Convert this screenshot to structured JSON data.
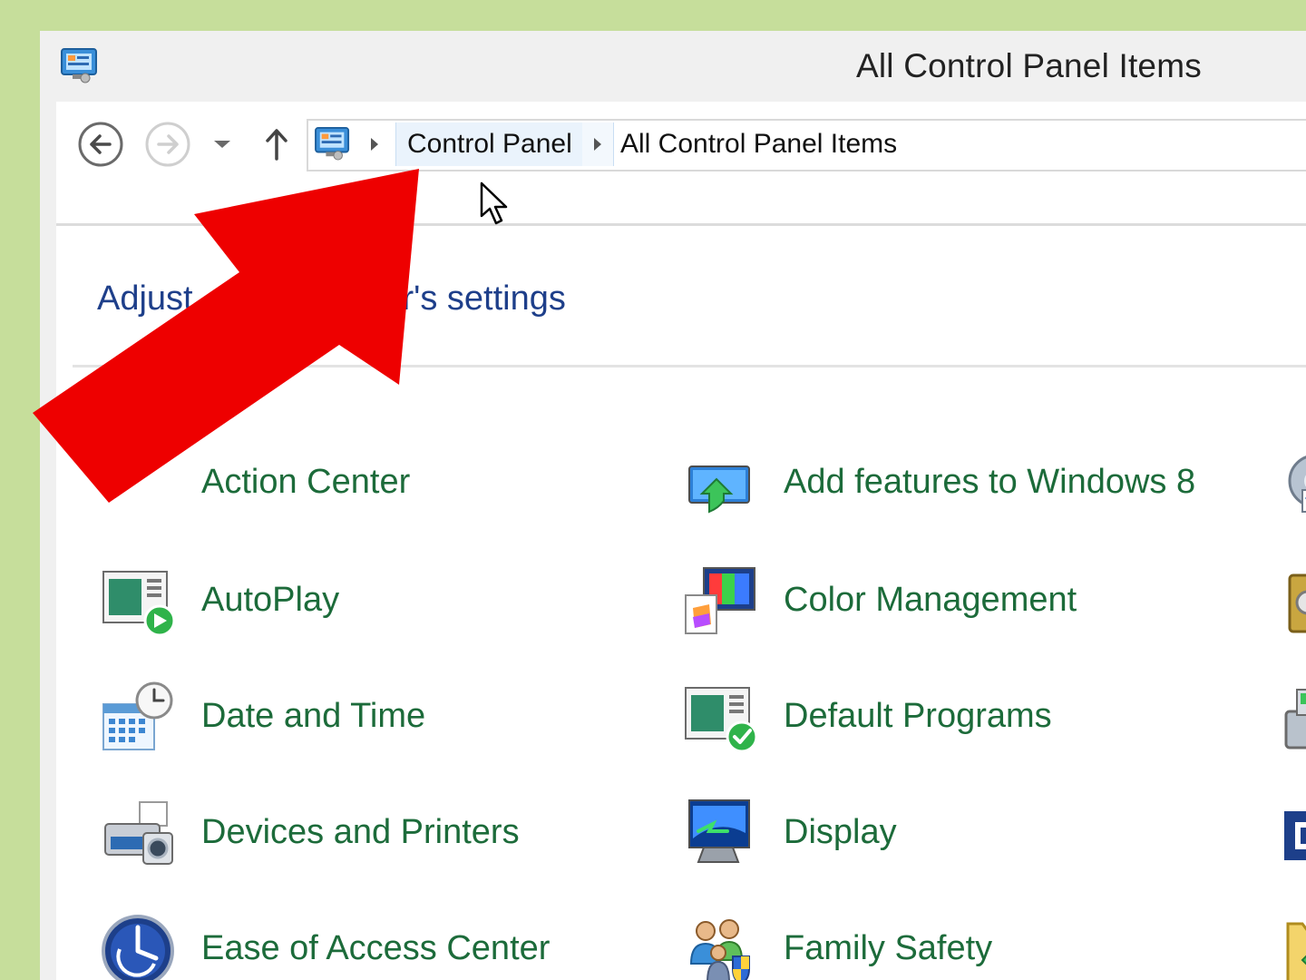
{
  "window": {
    "title": "All Control Panel Items"
  },
  "navigation": {
    "back_icon": "back-arrow-icon",
    "forward_icon": "forward-arrow-icon",
    "recent_icon": "chevron-down-icon",
    "up_icon": "up-arrow-icon"
  },
  "address_bar": {
    "crumbs": [
      "Control Panel",
      "All Control Panel Items"
    ]
  },
  "main": {
    "heading_visible_left": "Adjust",
    "heading_visible_right": "uter's settings",
    "items": [
      {
        "label": "Action Center",
        "icon": "action-center-icon"
      },
      {
        "label": "Add features to Windows 8",
        "icon": "add-features-icon"
      },
      {
        "label": "AutoPlay",
        "icon": "autoplay-icon"
      },
      {
        "label": "Color Management",
        "icon": "color-management-icon"
      },
      {
        "label": "Date and Time",
        "icon": "date-time-icon"
      },
      {
        "label": "Default Programs",
        "icon": "default-programs-icon"
      },
      {
        "label": "Devices and Printers",
        "icon": "devices-printers-icon"
      },
      {
        "label": "Display",
        "icon": "display-icon"
      },
      {
        "label": "Ease of Access Center",
        "icon": "ease-of-access-icon"
      },
      {
        "label": "Family Safety",
        "icon": "family-safety-icon"
      }
    ]
  },
  "annotation": {
    "arrow_color": "#ee0000",
    "arrow_target": "Control Panel"
  },
  "colors": {
    "background": "#c6de9b",
    "item_label": "#1c6b3a",
    "heading": "#1e3f8a"
  }
}
